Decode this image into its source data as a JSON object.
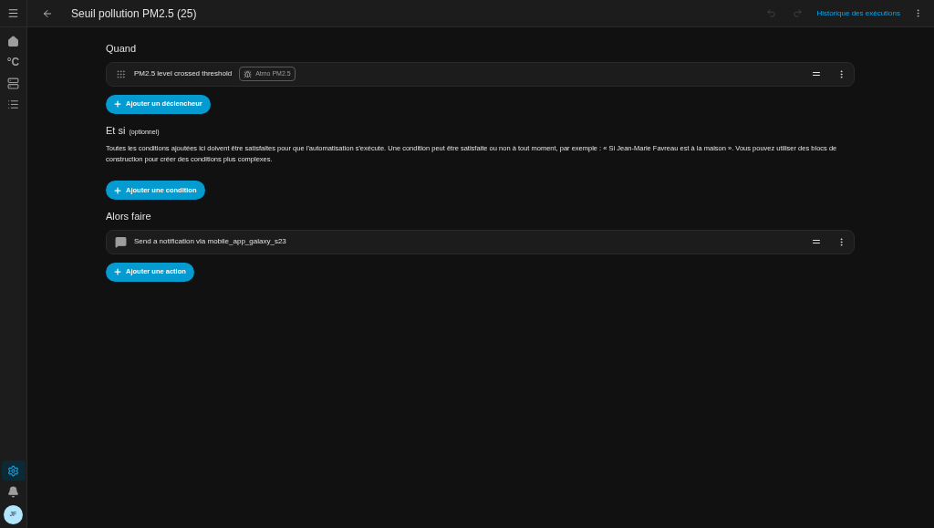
{
  "sidebar": {
    "items": [
      {
        "kind": "home",
        "selected": false
      },
      {
        "kind": "text",
        "label": "°C",
        "selected": false
      },
      {
        "kind": "storage",
        "selected": false
      },
      {
        "kind": "list",
        "selected": false
      }
    ],
    "bottom_items": [
      {
        "kind": "settings",
        "selected": true
      },
      {
        "kind": "bell",
        "selected": false
      }
    ],
    "avatar": "JF"
  },
  "header": {
    "title": "Seuil pollution PM2.5 (25)",
    "undo": {
      "disabled": true
    },
    "redo": {
      "disabled": true
    },
    "history_link": "Historique des exécutions"
  },
  "sections": [
    {
      "title": "Quand",
      "items": [
        {
          "kind": "trigger",
          "label": "PM2.5 level crossed threshold",
          "chip": "Atmo PM2.5"
        }
      ],
      "button": "Ajouter un déclencheur"
    },
    {
      "title": "Et si",
      "subtitle": "(optionnel)",
      "description": "Toutes les conditions ajoutées ici doivent être satisfaites pour que l'automatisation s'exécute. Une condition peut être satisfaite ou non à tout moment, par exemple : « Si Jean-Marie Favreau est à la maison ». Vous pouvez utiliser des blocs de construction pour créer des conditions plus complexes.",
      "button": "Ajouter une condition"
    },
    {
      "title": "Alors faire",
      "items": [
        {
          "kind": "notification",
          "label": "Send a notification via mobile_app_galaxy_s23"
        }
      ],
      "button": "Ajouter une action"
    }
  ]
}
